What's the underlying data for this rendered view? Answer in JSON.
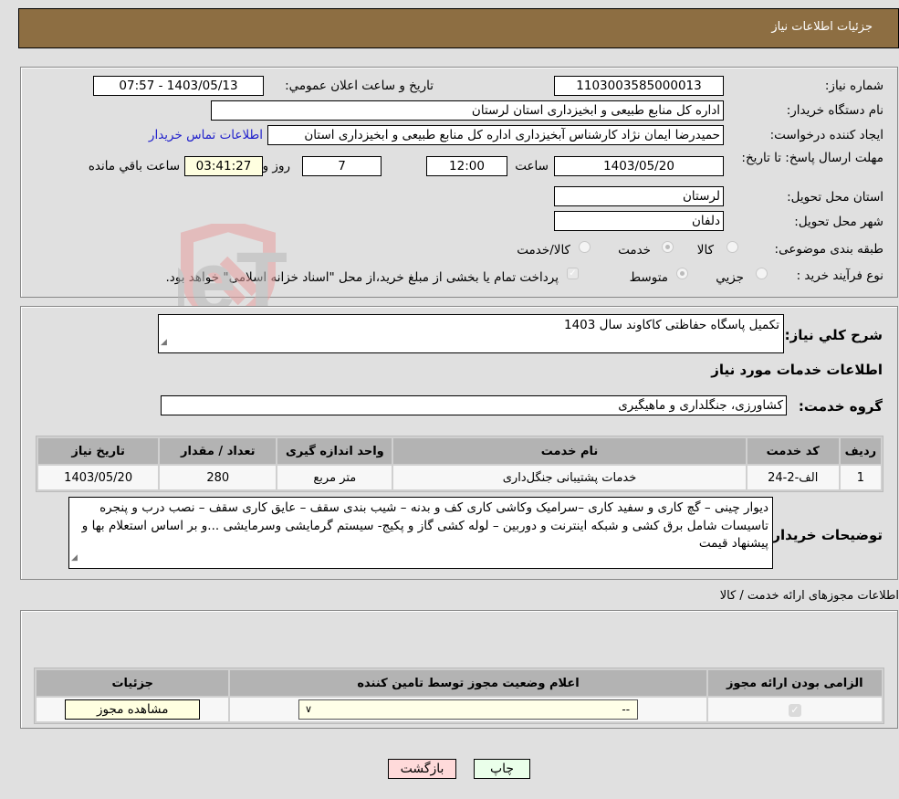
{
  "header": {
    "title": "جزئیات اطلاعات نیاز"
  },
  "details": {
    "need_number_label": "شماره نیاز:",
    "need_number": "1103003585000013",
    "announce_label": "تاریخ و ساعت اعلان عمومي:",
    "announce_value": "1403/05/13 - 07:57",
    "buyer_label": "نام دستگاه خریدار:",
    "buyer_value": "اداره کل منابع طبیعی و ابخیزداری استان لرستان",
    "creator_label": "ایجاد کننده درخواست:",
    "creator_value": "حمیدرضا ایمان نژاد کارشناس آبخیزداری اداره کل منابع طبیعی و ابخیزداری استان",
    "contact_link": "اطلاعات تماس خریدار",
    "deadline_label": "مهلت ارسال پاسخ: تا تاریخ:",
    "deadline_date": "1403/05/20",
    "time_label": "ساعت",
    "deadline_time": "12:00",
    "days_value": "7",
    "days_label": "روز و",
    "remaining_value": "03:41:27",
    "remaining_label": "ساعت باقي مانده",
    "province_label": "استان محل تحویل:",
    "province_value": "لرستان",
    "city_label": "شهر محل تحویل:",
    "city_value": "دلفان",
    "category_label": "طبقه بندی موضوعی:",
    "category_options": [
      {
        "label": "کالا",
        "checked": false
      },
      {
        "label": "خدمت",
        "checked": true
      },
      {
        "label": "کالا/خدمت",
        "checked": false
      }
    ],
    "process_label": "نوع فرآیند خرید :",
    "process_options": [
      {
        "label": "جزيي",
        "checked": false
      },
      {
        "label": "متوسط",
        "checked": true
      }
    ],
    "treasury_note": "پرداخت تمام یا بخشی از مبلغ خرید،از محل \"اسناد خزانه اسلامی\" خواهد بود.",
    "treasury_checked": true
  },
  "description": {
    "label": "شرح کلي نیاز:",
    "value": "تکمیل پاسگاه حفاظتی کاکاوند سال 1403"
  },
  "services": {
    "section_title": "اطلاعات خدمات مورد نیاز",
    "group_label": "گروه خدمت:",
    "group_value": "کشاورزی، جنگلداری و ماهیگیری",
    "table": {
      "headers": [
        "ردیف",
        "کد خدمت",
        "نام خدمت",
        "واحد اندازه گیری",
        "تعداد / مقدار",
        "تاریخ نیاز"
      ],
      "rows": [
        [
          "1",
          "الف-2-24",
          "خدمات پشتیبانی جنگل‌داری",
          "متر مربع",
          "280",
          "1403/05/20"
        ]
      ]
    }
  },
  "buyer_notes": {
    "label": "توضیحات خریدار:",
    "value": "دیوار چینی –  گچ کاری و سفید کاری –سرامیک  وکاشی کاری کف و بدنه – شیب بندی سقف – عایق کاری سقف – نصب درب و پنجره تاسیسات شامل برق کشی و شبکه اینترنت و دوربین  – لوله کشی گاز و پکیج- سیستم گرمایشی وسرمایشی ...و بر اساس استعلام بها و پیشنهاد قیمت"
  },
  "permits": {
    "section_title": "اطلاعات مجوزهای ارائه خدمت / کالا",
    "headers": [
      "الزامی بودن ارائه مجوز",
      "اعلام وضعیت مجوز توسط تامین کننده",
      "جزئیات"
    ],
    "row": {
      "required_checked": true,
      "status_value": "--",
      "details_button": "مشاهده مجوز"
    }
  },
  "actions": {
    "print_label": "چاپ",
    "back_label": "بازگشت"
  },
  "watermark": {
    "text": "AriaTender.neT"
  }
}
